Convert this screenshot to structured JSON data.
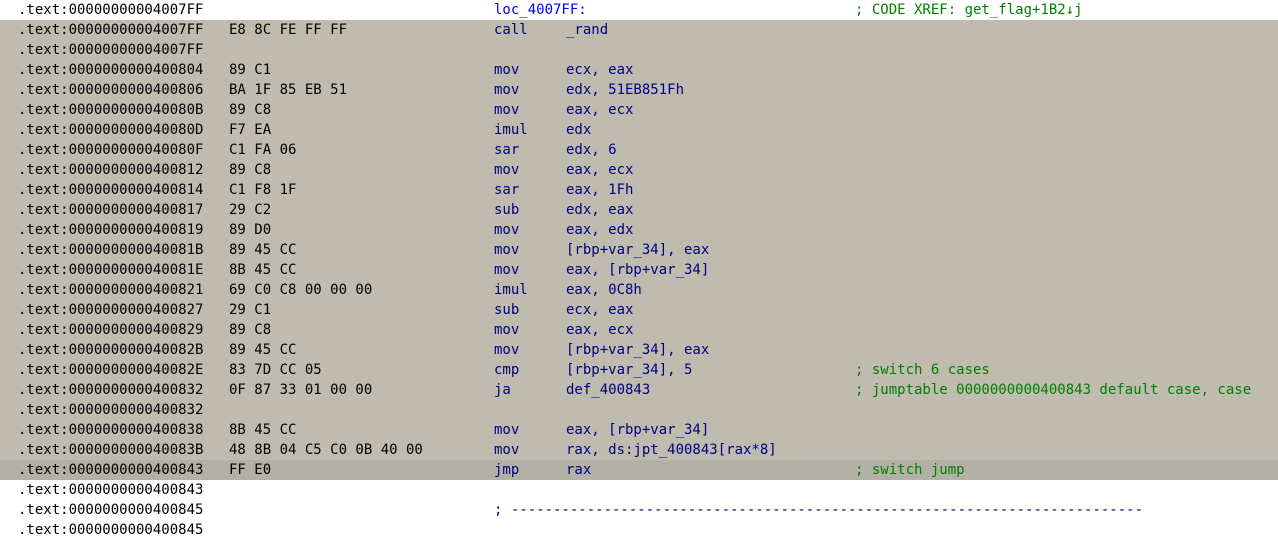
{
  "theme": {
    "selection_bg": "#bfbbae",
    "current_line_bg": "#b3b0a5",
    "address_color": "#000000",
    "label_color": "#0000ff",
    "instruction_color": "#000080",
    "comment_color": "#008000"
  },
  "rows": [
    {
      "addr": ".text:00000000004007FF",
      "bytes": "",
      "label": "loc_4007FF:",
      "mnem": "",
      "ops": "",
      "cmt": "; CODE XREF: get_flag+1B2↓j",
      "hl": "none"
    },
    {
      "addr": ".text:00000000004007FF",
      "bytes": "E8 8C FE FF FF",
      "label": "",
      "mnem": "call",
      "ops": "_rand",
      "cmt": "",
      "hl": "sel"
    },
    {
      "addr": ".text:00000000004007FF",
      "bytes": "",
      "label": "",
      "mnem": "",
      "ops": "",
      "cmt": "",
      "hl": "sel"
    },
    {
      "addr": ".text:0000000000400804",
      "bytes": "89 C1",
      "label": "",
      "mnem": "mov",
      "ops": "ecx, eax",
      "cmt": "",
      "hl": "sel"
    },
    {
      "addr": ".text:0000000000400806",
      "bytes": "BA 1F 85 EB 51",
      "label": "",
      "mnem": "mov",
      "ops": "edx, 51EB851Fh",
      "cmt": "",
      "hl": "sel"
    },
    {
      "addr": ".text:000000000040080B",
      "bytes": "89 C8",
      "label": "",
      "mnem": "mov",
      "ops": "eax, ecx",
      "cmt": "",
      "hl": "sel"
    },
    {
      "addr": ".text:000000000040080D",
      "bytes": "F7 EA",
      "label": "",
      "mnem": "imul",
      "ops": "edx",
      "cmt": "",
      "hl": "sel"
    },
    {
      "addr": ".text:000000000040080F",
      "bytes": "C1 FA 06",
      "label": "",
      "mnem": "sar",
      "ops": "edx, 6",
      "cmt": "",
      "hl": "sel"
    },
    {
      "addr": ".text:0000000000400812",
      "bytes": "89 C8",
      "label": "",
      "mnem": "mov",
      "ops": "eax, ecx",
      "cmt": "",
      "hl": "sel"
    },
    {
      "addr": ".text:0000000000400814",
      "bytes": "C1 F8 1F",
      "label": "",
      "mnem": "sar",
      "ops": "eax, 1Fh",
      "cmt": "",
      "hl": "sel"
    },
    {
      "addr": ".text:0000000000400817",
      "bytes": "29 C2",
      "label": "",
      "mnem": "sub",
      "ops": "edx, eax",
      "cmt": "",
      "hl": "sel"
    },
    {
      "addr": ".text:0000000000400819",
      "bytes": "89 D0",
      "label": "",
      "mnem": "mov",
      "ops": "eax, edx",
      "cmt": "",
      "hl": "sel"
    },
    {
      "addr": ".text:000000000040081B",
      "bytes": "89 45 CC",
      "label": "",
      "mnem": "mov",
      "ops": "[rbp+var_34], eax",
      "cmt": "",
      "hl": "sel"
    },
    {
      "addr": ".text:000000000040081E",
      "bytes": "8B 45 CC",
      "label": "",
      "mnem": "mov",
      "ops": "eax, [rbp+var_34]",
      "cmt": "",
      "hl": "sel"
    },
    {
      "addr": ".text:0000000000400821",
      "bytes": "69 C0 C8 00 00 00",
      "label": "",
      "mnem": "imul",
      "ops": "eax, 0C8h",
      "cmt": "",
      "hl": "sel"
    },
    {
      "addr": ".text:0000000000400827",
      "bytes": "29 C1",
      "label": "",
      "mnem": "sub",
      "ops": "ecx, eax",
      "cmt": "",
      "hl": "sel"
    },
    {
      "addr": ".text:0000000000400829",
      "bytes": "89 C8",
      "label": "",
      "mnem": "mov",
      "ops": "eax, ecx",
      "cmt": "",
      "hl": "sel"
    },
    {
      "addr": ".text:000000000040082B",
      "bytes": "89 45 CC",
      "label": "",
      "mnem": "mov",
      "ops": "[rbp+var_34], eax",
      "cmt": "",
      "hl": "sel"
    },
    {
      "addr": ".text:000000000040082E",
      "bytes": "83 7D CC 05",
      "label": "",
      "mnem": "cmp",
      "ops": "[rbp+var_34], 5",
      "cmt": "; switch 6 cases",
      "hl": "sel"
    },
    {
      "addr": ".text:0000000000400832",
      "bytes": "0F 87 33 01 00 00",
      "label": "",
      "mnem": "ja",
      "ops": "def_400843",
      "cmt": "; jumptable 0000000000400843 default case, case",
      "hl": "sel"
    },
    {
      "addr": ".text:0000000000400832",
      "bytes": "",
      "label": "",
      "mnem": "",
      "ops": "",
      "cmt": "",
      "hl": "sel"
    },
    {
      "addr": ".text:0000000000400838",
      "bytes": "8B 45 CC",
      "label": "",
      "mnem": "mov",
      "ops": "eax, [rbp+var_34]",
      "cmt": "",
      "hl": "sel"
    },
    {
      "addr": ".text:000000000040083B",
      "bytes": "48 8B 04 C5 C0 0B 40 00",
      "label": "",
      "mnem": "mov",
      "ops": "rax, ds:jpt_400843[rax*8]",
      "cmt": "",
      "hl": "sel"
    },
    {
      "addr": ".text:0000000000400843",
      "bytes": "FF E0",
      "label": "",
      "mnem": "jmp",
      "ops": "rax",
      "cmt": "; switch jump",
      "hl": "cur"
    },
    {
      "addr": ".text:0000000000400843",
      "bytes": "",
      "label": "",
      "mnem": "",
      "ops": "",
      "cmt": "",
      "hl": "none"
    },
    {
      "addr": ".text:0000000000400845",
      "bytes": "",
      "label": "",
      "mnem": "",
      "ops": "",
      "cmt": "",
      "sep": "; ---------------------------------------------------------------------------",
      "hl": "none"
    },
    {
      "addr": ".text:0000000000400845",
      "bytes": "",
      "label": "",
      "mnem": "",
      "ops": "",
      "cmt": "",
      "hl": "none"
    }
  ]
}
